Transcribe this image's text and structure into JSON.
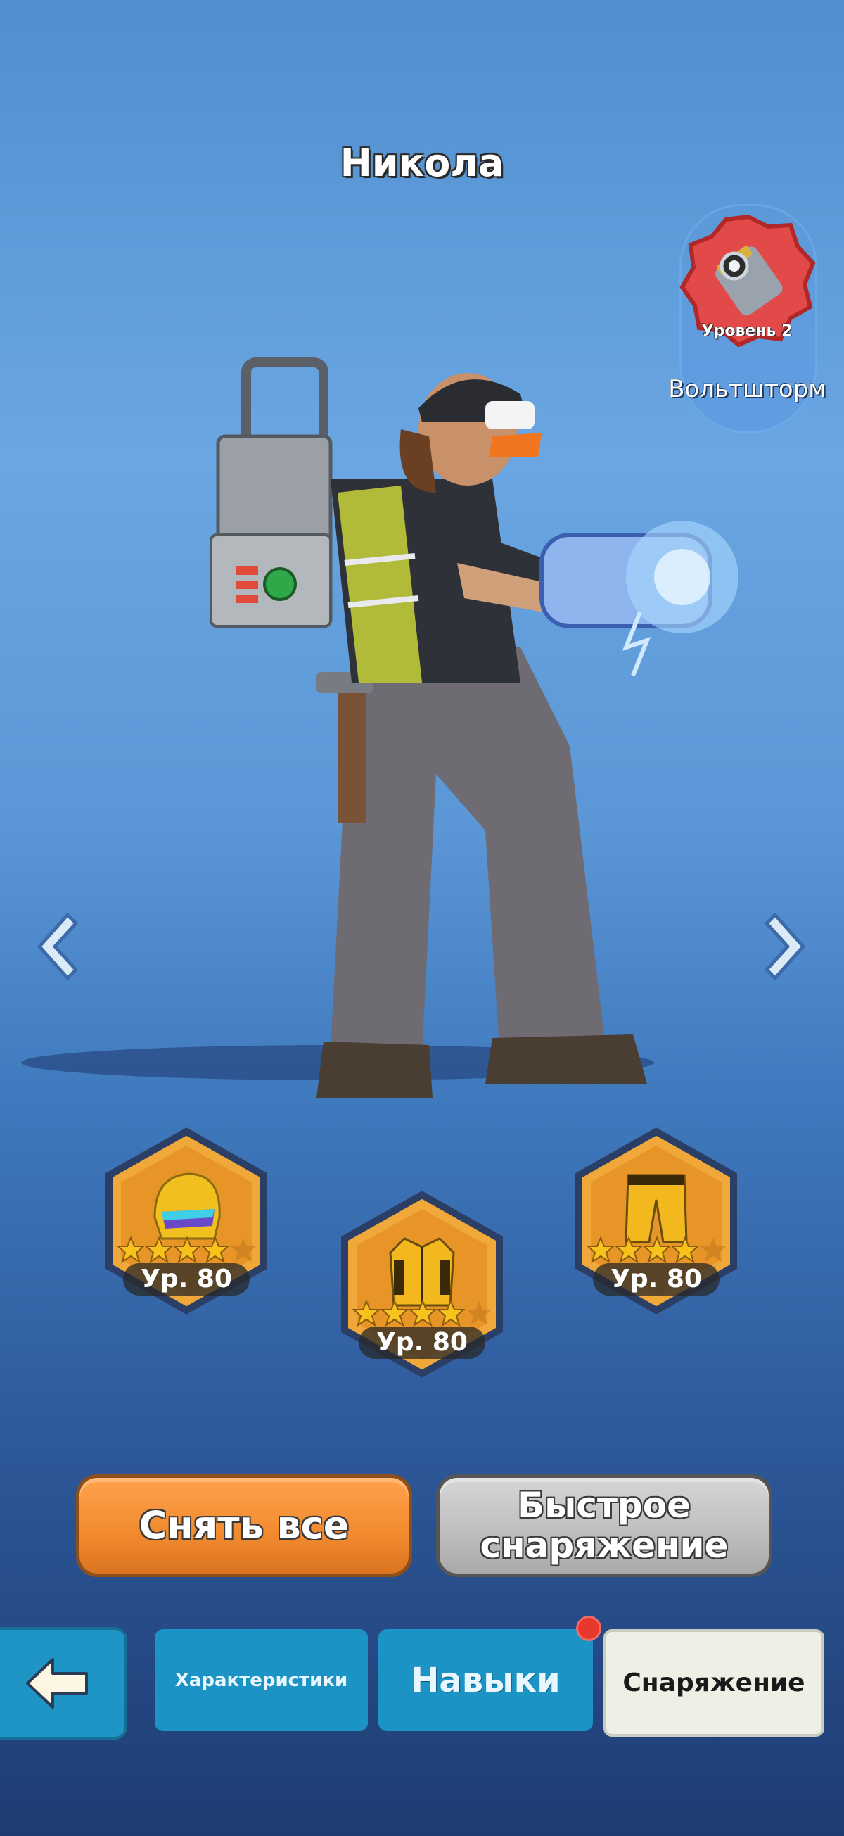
{
  "hero": {
    "name": "Никола"
  },
  "weapon": {
    "level_label": "Уровень 2",
    "name": "Вольтшторм"
  },
  "equipment": [
    {
      "slot": "helmet",
      "icon": "helmet-icon",
      "stars": 4,
      "level_label": "Ур. 80"
    },
    {
      "slot": "jacket",
      "icon": "jacket-icon",
      "stars": 4,
      "level_label": "Ур. 80"
    },
    {
      "slot": "pants",
      "icon": "pants-icon",
      "stars": 4,
      "level_label": "Ур. 80"
    }
  ],
  "actions": {
    "remove_all": "Снять все",
    "quick_equip_line1": "Быстрое",
    "quick_equip_line2": "снаряжение"
  },
  "tabs": {
    "stats": "Характеристики",
    "skills": "Навыки",
    "gear": "Снаряжение",
    "skills_has_notification": true
  },
  "colors": {
    "remove_button": "#f18a2e",
    "quick_button": "#bdbdbd",
    "tab_active": "#eef0e6",
    "tab_inactive": "#1b93c4",
    "gear_frame": "#f0a83a",
    "notification_dot": "#e8372c"
  }
}
